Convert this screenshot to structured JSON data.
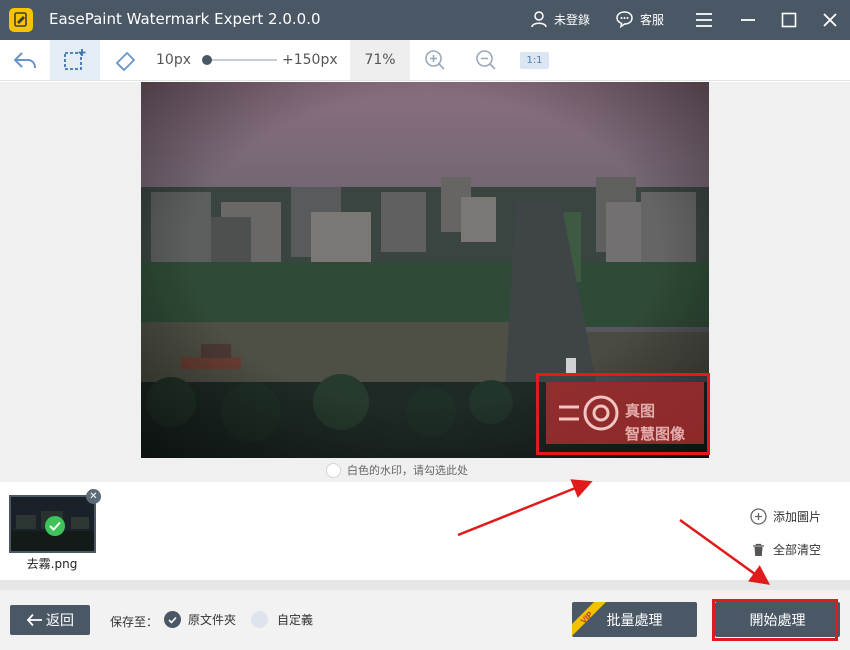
{
  "window": {
    "title": "EasePaint Watermark Expert  2.0.0.0",
    "user_label": "未登錄",
    "support_label": "客服"
  },
  "toolbar": {
    "brush_min": "10px",
    "brush_max": "+150px",
    "brush_level": 0.0,
    "zoom": "71%",
    "ratio_label": "1:1"
  },
  "canvas": {
    "watermark_line1": "真图",
    "watermark_line2": "智慧图像",
    "white_watermark_option": "白色的水印，请勾选此处"
  },
  "thumbnails": [
    {
      "name": "去霧.png",
      "status": "done"
    }
  ],
  "side_actions": {
    "add_image": "添加圖片",
    "clear_all": "全部清空"
  },
  "bottom": {
    "back_label": "返回",
    "save_to_label": "保存至：",
    "save_options": [
      {
        "label": "原文件夾",
        "selected": true
      },
      {
        "label": "自定義",
        "selected": false
      }
    ],
    "vip_badge": "VIP",
    "batch_label": "批量處理",
    "start_label": "開始處理"
  },
  "colors": {
    "titlebar": "#4a5764",
    "accent_button": "#4a5764",
    "highlight_red": "#e01b1b",
    "logo_yellow": "#f5c400",
    "success_green": "#3ec35b"
  }
}
